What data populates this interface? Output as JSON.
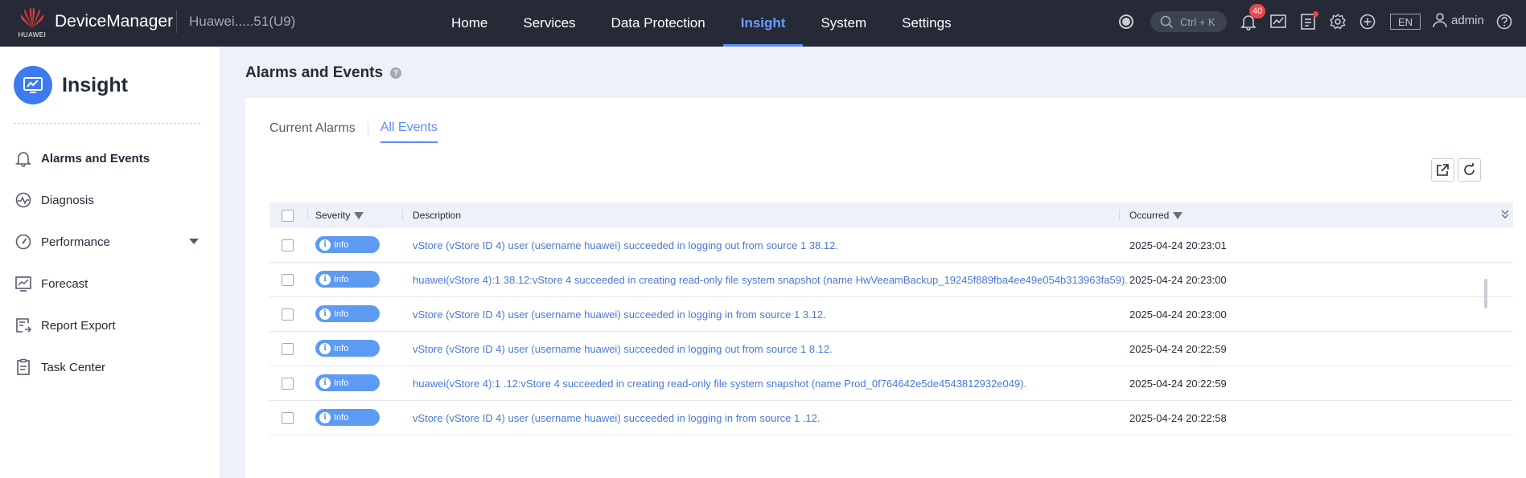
{
  "topbar": {
    "logo_text": "HUAWEI",
    "app_title": "DeviceManager",
    "device_name": "Huawei.....51(U9)",
    "nav": [
      {
        "label": "Home"
      },
      {
        "label": "Services"
      },
      {
        "label": "Data Protection"
      },
      {
        "label": "Insight",
        "active": true
      },
      {
        "label": "System"
      },
      {
        "label": "Settings"
      }
    ],
    "search_shortcut": "Ctrl + K",
    "alarm_count": "40",
    "language": "EN",
    "user": "admin"
  },
  "sidebar": {
    "title": "Insight",
    "items": [
      {
        "label": "Alarms and Events",
        "icon": "bell-icon",
        "active": true
      },
      {
        "label": "Diagnosis",
        "icon": "diagnosis-icon"
      },
      {
        "label": "Performance",
        "icon": "gauge-icon",
        "expandable": true
      },
      {
        "label": "Forecast",
        "icon": "chart-icon"
      },
      {
        "label": "Report Export",
        "icon": "report-icon"
      },
      {
        "label": "Task Center",
        "icon": "clipboard-icon"
      }
    ]
  },
  "main": {
    "title": "Alarms and Events",
    "tabs": [
      {
        "label": "Current Alarms"
      },
      {
        "label": "All Events",
        "active": true
      }
    ],
    "table": {
      "headers": {
        "severity": "Severity",
        "description": "Description",
        "occurred": "Occurred"
      },
      "rows": [
        {
          "severity": "Info",
          "description": "vStore (vStore ID 4) user (username huawei) succeeded in logging out from source 1           38.12.",
          "occurred": "2025-04-24 20:23:01"
        },
        {
          "severity": "Info",
          "description": "huawei(vStore 4):1              38.12:vStore 4 succeeded in creating read-only file system snapshot (name HwVeeamBackup_19245f889fba4ee49e054b313963fa59).",
          "occurred": "2025-04-24 20:23:00"
        },
        {
          "severity": "Info",
          "description": "vStore (vStore ID 4) user (username huawei) succeeded in logging in from source 1          3.12.",
          "occurred": "2025-04-24 20:23:00"
        },
        {
          "severity": "Info",
          "description": "vStore (vStore ID 4) user (username huawei) succeeded in logging out from source 1          8.12.",
          "occurred": "2025-04-24 20:22:59"
        },
        {
          "severity": "Info",
          "description": "huawei(vStore 4):1             .12:vStore 4 succeeded in creating read-only file system snapshot (name Prod_0f764642e5de4543812932e049).",
          "occurred": "2025-04-24 20:22:59"
        },
        {
          "severity": "Info",
          "description": "vStore (vStore ID 4) user (username huawei) succeeded in logging in from source 1           .12.",
          "occurred": "2025-04-24 20:22:58"
        }
      ]
    }
  },
  "colors": {
    "accent": "#5e8cff",
    "topbar": "#252a36",
    "info_badge": "#5d9bf2",
    "link": "#4a78d6"
  }
}
